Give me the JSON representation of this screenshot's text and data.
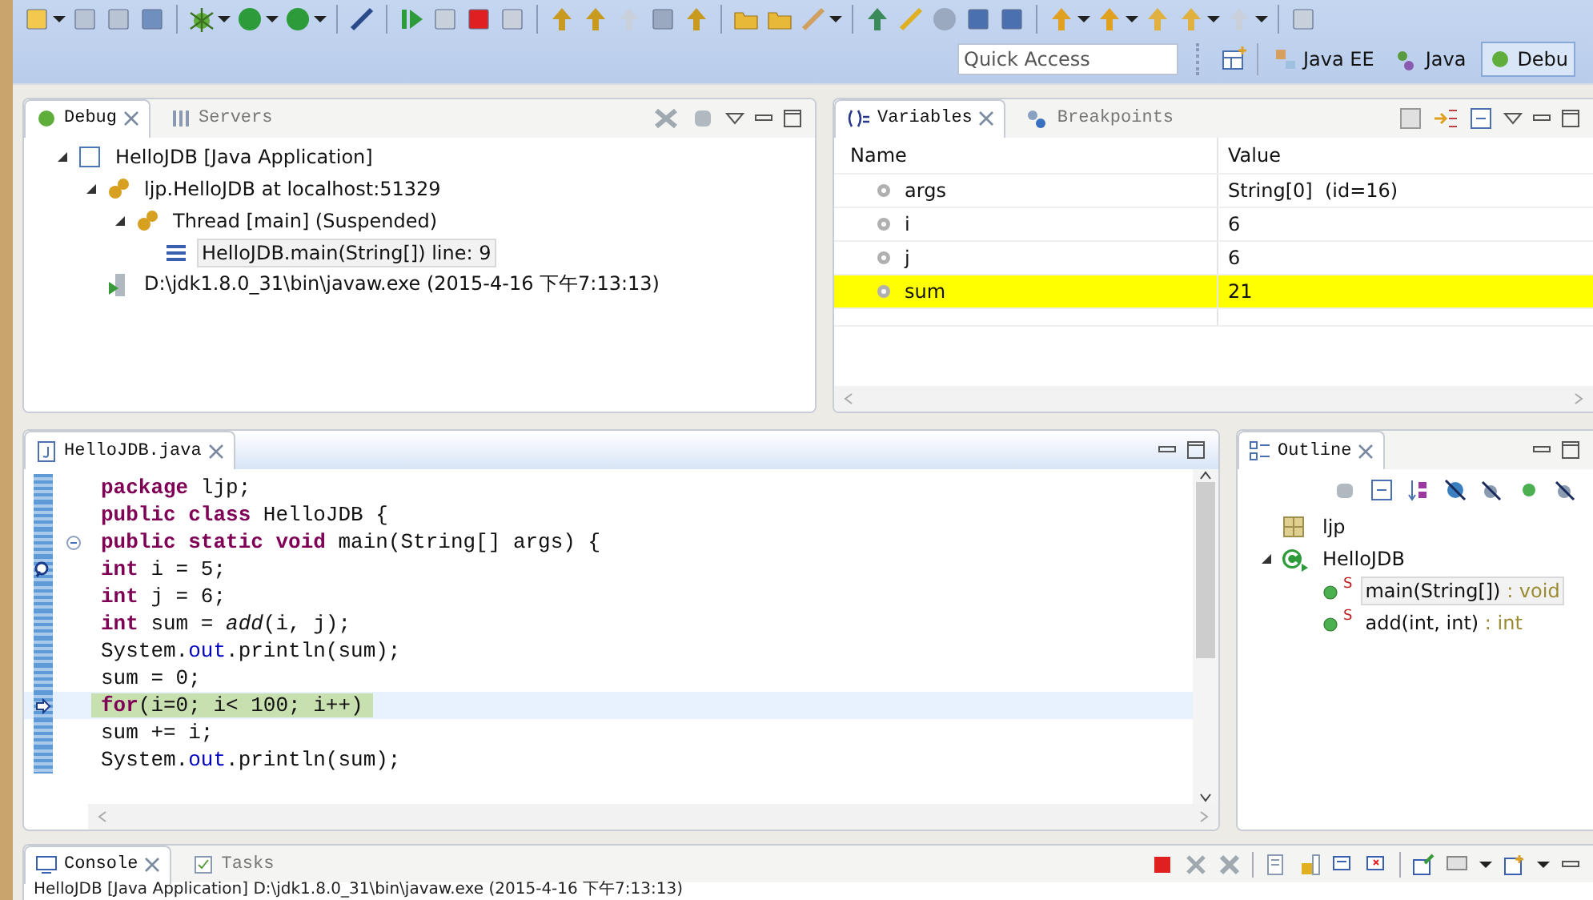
{
  "perspective_bar": {
    "quick_access": {
      "placeholder": "Quick Access"
    },
    "perspectives": [
      {
        "label": "Java EE",
        "kind": "javaee",
        "selected": false
      },
      {
        "label": "Java",
        "kind": "java",
        "selected": false
      },
      {
        "label": "Debu",
        "kind": "debug",
        "selected": true
      }
    ]
  },
  "debug_panel": {
    "tabs": [
      {
        "label": "Debug",
        "kind": "debug",
        "selected": true
      },
      {
        "label": "Servers",
        "kind": "servers",
        "selected": false
      }
    ],
    "tree": [
      {
        "label": "HelloJDB [Java Application]",
        "kind": "launch",
        "expanded": true,
        "selected": false,
        "children": [
          {
            "label": "ljp.HelloJDB at localhost:51329",
            "kind": "vm",
            "expanded": true,
            "selected": false,
            "children": [
              {
                "label": "Thread [main] (Suspended)",
                "kind": "thread",
                "expanded": true,
                "selected": false,
                "children": [
                  {
                    "label": "HelloJDB.main(String[]) line: 9",
                    "kind": "frame",
                    "selected": true
                  }
                ]
              }
            ]
          },
          {
            "label": "D:\\jdk1.8.0_31\\bin\\javaw.exe (2015-4-16 下午7:13:13)",
            "kind": "process",
            "selected": false
          }
        ]
      }
    ]
  },
  "variables_panel": {
    "tabs": [
      {
        "label": "Variables",
        "kind": "variables",
        "selected": true
      },
      {
        "label": "Breakpoints",
        "kind": "breakpoints",
        "selected": false
      }
    ],
    "columns": [
      "Name",
      "Value"
    ],
    "rows": [
      {
        "name": "args",
        "value": "String[0]  (id=16)",
        "changed": false
      },
      {
        "name": "i",
        "value": "6",
        "changed": false
      },
      {
        "name": "j",
        "value": "6",
        "changed": false
      },
      {
        "name": "sum",
        "value": "21",
        "changed": true
      }
    ]
  },
  "editor": {
    "tabs": [
      {
        "label": "HelloJDB.java",
        "kind": "java",
        "selected": true
      }
    ],
    "lines": [
      {
        "tokens": [
          {
            "kind": "keyword",
            "text": "package"
          },
          {
            "kind": "plain",
            "text": " ljp;"
          }
        ],
        "breakpoint": false,
        "current": false,
        "foldable": false
      },
      {
        "tokens": [
          {
            "kind": "keyword",
            "text": "public class"
          },
          {
            "kind": "plain",
            "text": " HelloJDB {"
          }
        ],
        "breakpoint": false,
        "current": false,
        "foldable": false
      },
      {
        "tokens": [
          {
            "kind": "keyword",
            "text": "public static void"
          },
          {
            "kind": "plain",
            "text": " main(String[] args) {"
          }
        ],
        "breakpoint": false,
        "current": false,
        "foldable": true
      },
      {
        "tokens": [
          {
            "kind": "keyword",
            "text": "int"
          },
          {
            "kind": "plain",
            "text": " i = 5;"
          }
        ],
        "breakpoint": true,
        "current": false,
        "foldable": false
      },
      {
        "tokens": [
          {
            "kind": "keyword",
            "text": "int"
          },
          {
            "kind": "plain",
            "text": " j = 6;"
          }
        ],
        "breakpoint": false,
        "current": false,
        "foldable": false
      },
      {
        "tokens": [
          {
            "kind": "keyword",
            "text": "int"
          },
          {
            "kind": "plain",
            "text": " sum = "
          },
          {
            "kind": "method",
            "text": "add"
          },
          {
            "kind": "plain",
            "text": "(i, j);"
          }
        ],
        "breakpoint": false,
        "current": false,
        "foldable": false
      },
      {
        "tokens": [
          {
            "kind": "plain",
            "text": "System."
          },
          {
            "kind": "field",
            "text": "out"
          },
          {
            "kind": "plain",
            "text": ".println(sum);"
          }
        ],
        "breakpoint": false,
        "current": false,
        "foldable": false
      },
      {
        "tokens": [
          {
            "kind": "plain",
            "text": "sum = 0;"
          }
        ],
        "breakpoint": false,
        "current": false,
        "foldable": false
      },
      {
        "tokens": [
          {
            "kind": "keyword",
            "text": "for"
          },
          {
            "kind": "plain",
            "text": "(i=0; i< 100; i++)"
          }
        ],
        "breakpoint": false,
        "current": true,
        "foldable": false
      },
      {
        "tokens": [
          {
            "kind": "plain",
            "text": "sum += i;"
          }
        ],
        "breakpoint": false,
        "current": false,
        "foldable": false
      },
      {
        "tokens": [
          {
            "kind": "plain",
            "text": "System."
          },
          {
            "kind": "field",
            "text": "out"
          },
          {
            "kind": "plain",
            "text": ".println(sum);"
          }
        ],
        "breakpoint": false,
        "current": false,
        "foldable": false
      }
    ]
  },
  "outline_panel": {
    "tabs": [
      {
        "label": "Outline",
        "kind": "outline",
        "selected": true
      }
    ],
    "tree": [
      {
        "label": "ljp",
        "kind": "package",
        "selected": false
      },
      {
        "label": "HelloJDB",
        "kind": "class",
        "expanded": true,
        "selected": false,
        "children": [
          {
            "label": "main(String[])",
            "type": " : void",
            "modifier": "S",
            "kind": "method",
            "selected": true
          },
          {
            "label": "add(int, int)",
            "type": " : int",
            "modifier": "S",
            "kind": "method",
            "selected": false
          }
        ]
      }
    ]
  },
  "console_panel": {
    "tabs": [
      {
        "label": "Console",
        "kind": "console",
        "selected": true
      },
      {
        "label": "Tasks",
        "kind": "tasks",
        "selected": false
      }
    ],
    "text": "HelloJDB [Java Application] D:\\jdk1.8.0_31\\bin\\javaw.exe (2015-4-16 下午7:13:13)"
  }
}
